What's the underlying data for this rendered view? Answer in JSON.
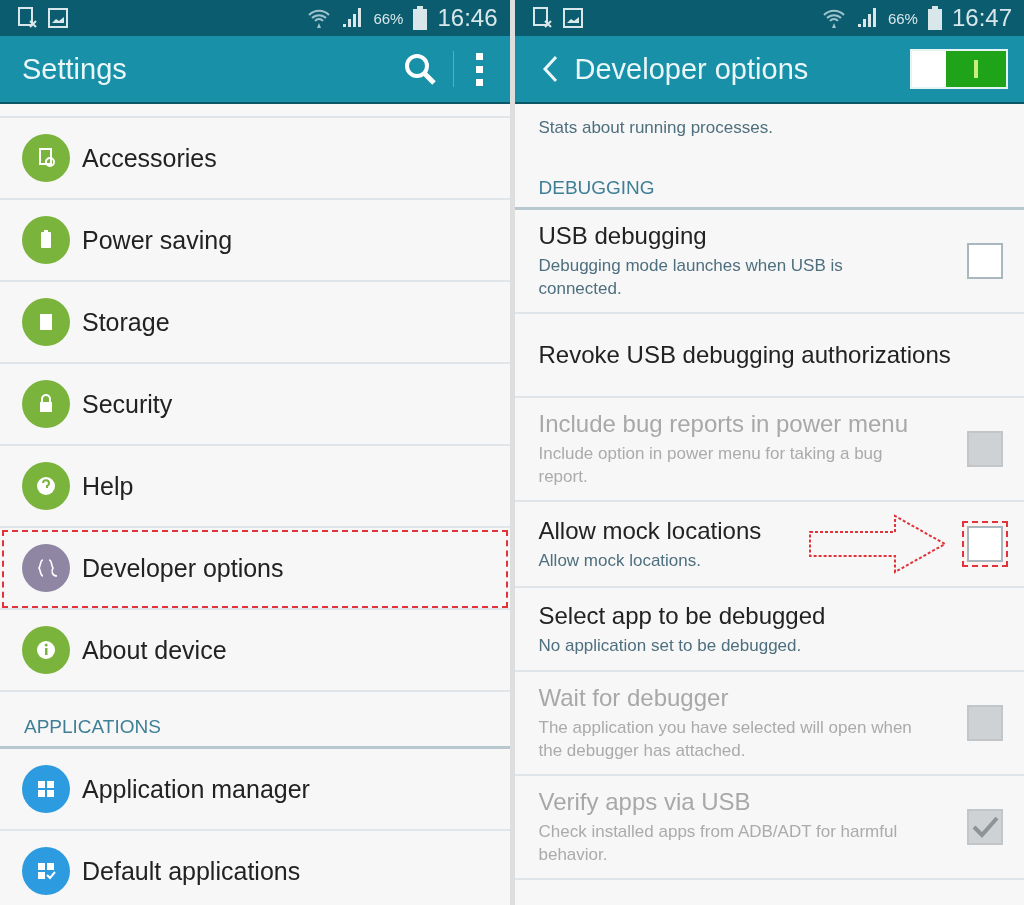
{
  "left": {
    "status": {
      "battery": "66%",
      "time": "16:46"
    },
    "title": "Settings",
    "items": [
      {
        "kind": "item",
        "label": "Accessories",
        "color": "#7ab43c",
        "highlighted": false
      },
      {
        "kind": "item",
        "label": "Power saving",
        "color": "#7ab43c",
        "highlighted": false
      },
      {
        "kind": "item",
        "label": "Storage",
        "color": "#7ab43c",
        "highlighted": false
      },
      {
        "kind": "item",
        "label": "Security",
        "color": "#7ab43c",
        "highlighted": false
      },
      {
        "kind": "item",
        "label": "Help",
        "color": "#7ab43c",
        "highlighted": false
      },
      {
        "kind": "item",
        "label": "Developer options",
        "color": "#8e86a3",
        "highlighted": true
      },
      {
        "kind": "item",
        "label": "About device",
        "color": "#7ab43c",
        "highlighted": false
      },
      {
        "kind": "header",
        "label": "APPLICATIONS"
      },
      {
        "kind": "item",
        "label": "Application manager",
        "color": "#2c9be0",
        "highlighted": false
      },
      {
        "kind": "item",
        "label": "Default applications",
        "color": "#2c9be0",
        "highlighted": false
      }
    ]
  },
  "right": {
    "status": {
      "battery": "66%",
      "time": "16:47"
    },
    "title": "Developer options",
    "master_switch": {
      "on": true
    },
    "items": [
      {
        "kind": "partial",
        "subtitle": "Stats about running processes."
      },
      {
        "kind": "header",
        "label": "DEBUGGING"
      },
      {
        "kind": "checkbox",
        "title": "USB debugging",
        "subtitle": "Debugging mode launches when USB is connected.",
        "checked": false,
        "disabled": false,
        "highlighted": false
      },
      {
        "kind": "plain",
        "title": "Revoke USB debugging authorizations",
        "disabled": false
      },
      {
        "kind": "checkbox",
        "title": "Include bug reports in power menu",
        "subtitle": "Include option in power menu for taking a bug report.",
        "checked": false,
        "disabled": true,
        "highlighted": false
      },
      {
        "kind": "checkbox",
        "title": "Allow mock locations",
        "subtitle": "Allow mock locations.",
        "checked": false,
        "disabled": false,
        "highlighted": true
      },
      {
        "kind": "plain",
        "title": "Select app to be debugged",
        "subtitle": "No application set to be debugged.",
        "disabled": false
      },
      {
        "kind": "checkbox",
        "title": "Wait for debugger",
        "subtitle": "The application you have selected will open when the debugger has attached.",
        "checked": false,
        "disabled": true,
        "highlighted": false
      },
      {
        "kind": "checkbox",
        "title": "Verify apps via USB",
        "subtitle": "Check installed apps from ADB/ADT for harmful behavior.",
        "checked": true,
        "disabled": true,
        "highlighted": false
      }
    ]
  }
}
